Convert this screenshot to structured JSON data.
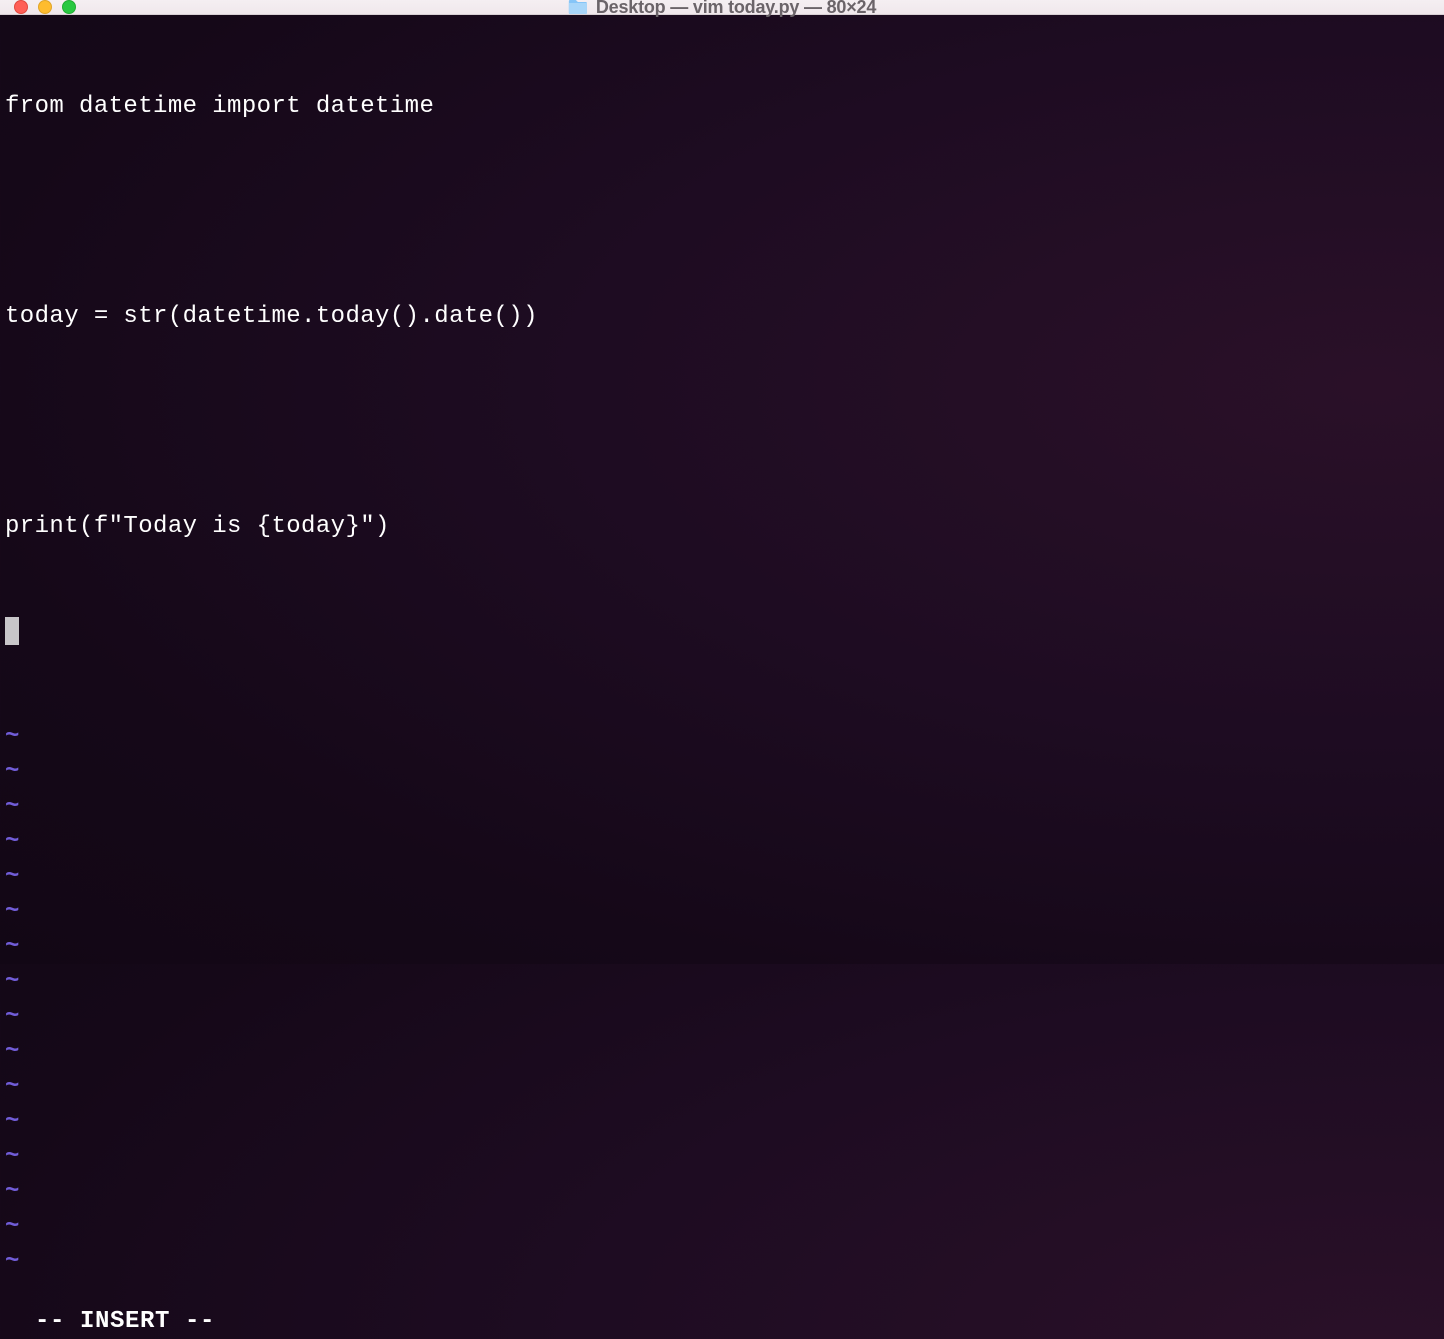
{
  "titlebar": {
    "title": "Desktop — vim today.py — 80×24"
  },
  "editor": {
    "lines": [
      "from datetime import datetime",
      "",
      "today = str(datetime.today().date())",
      "",
      "print(f\"Today is {today}\")"
    ],
    "cursor_line_present": true,
    "tilde_count": 16,
    "tilde_char": "~"
  },
  "status": {
    "mode": "-- INSERT --"
  }
}
